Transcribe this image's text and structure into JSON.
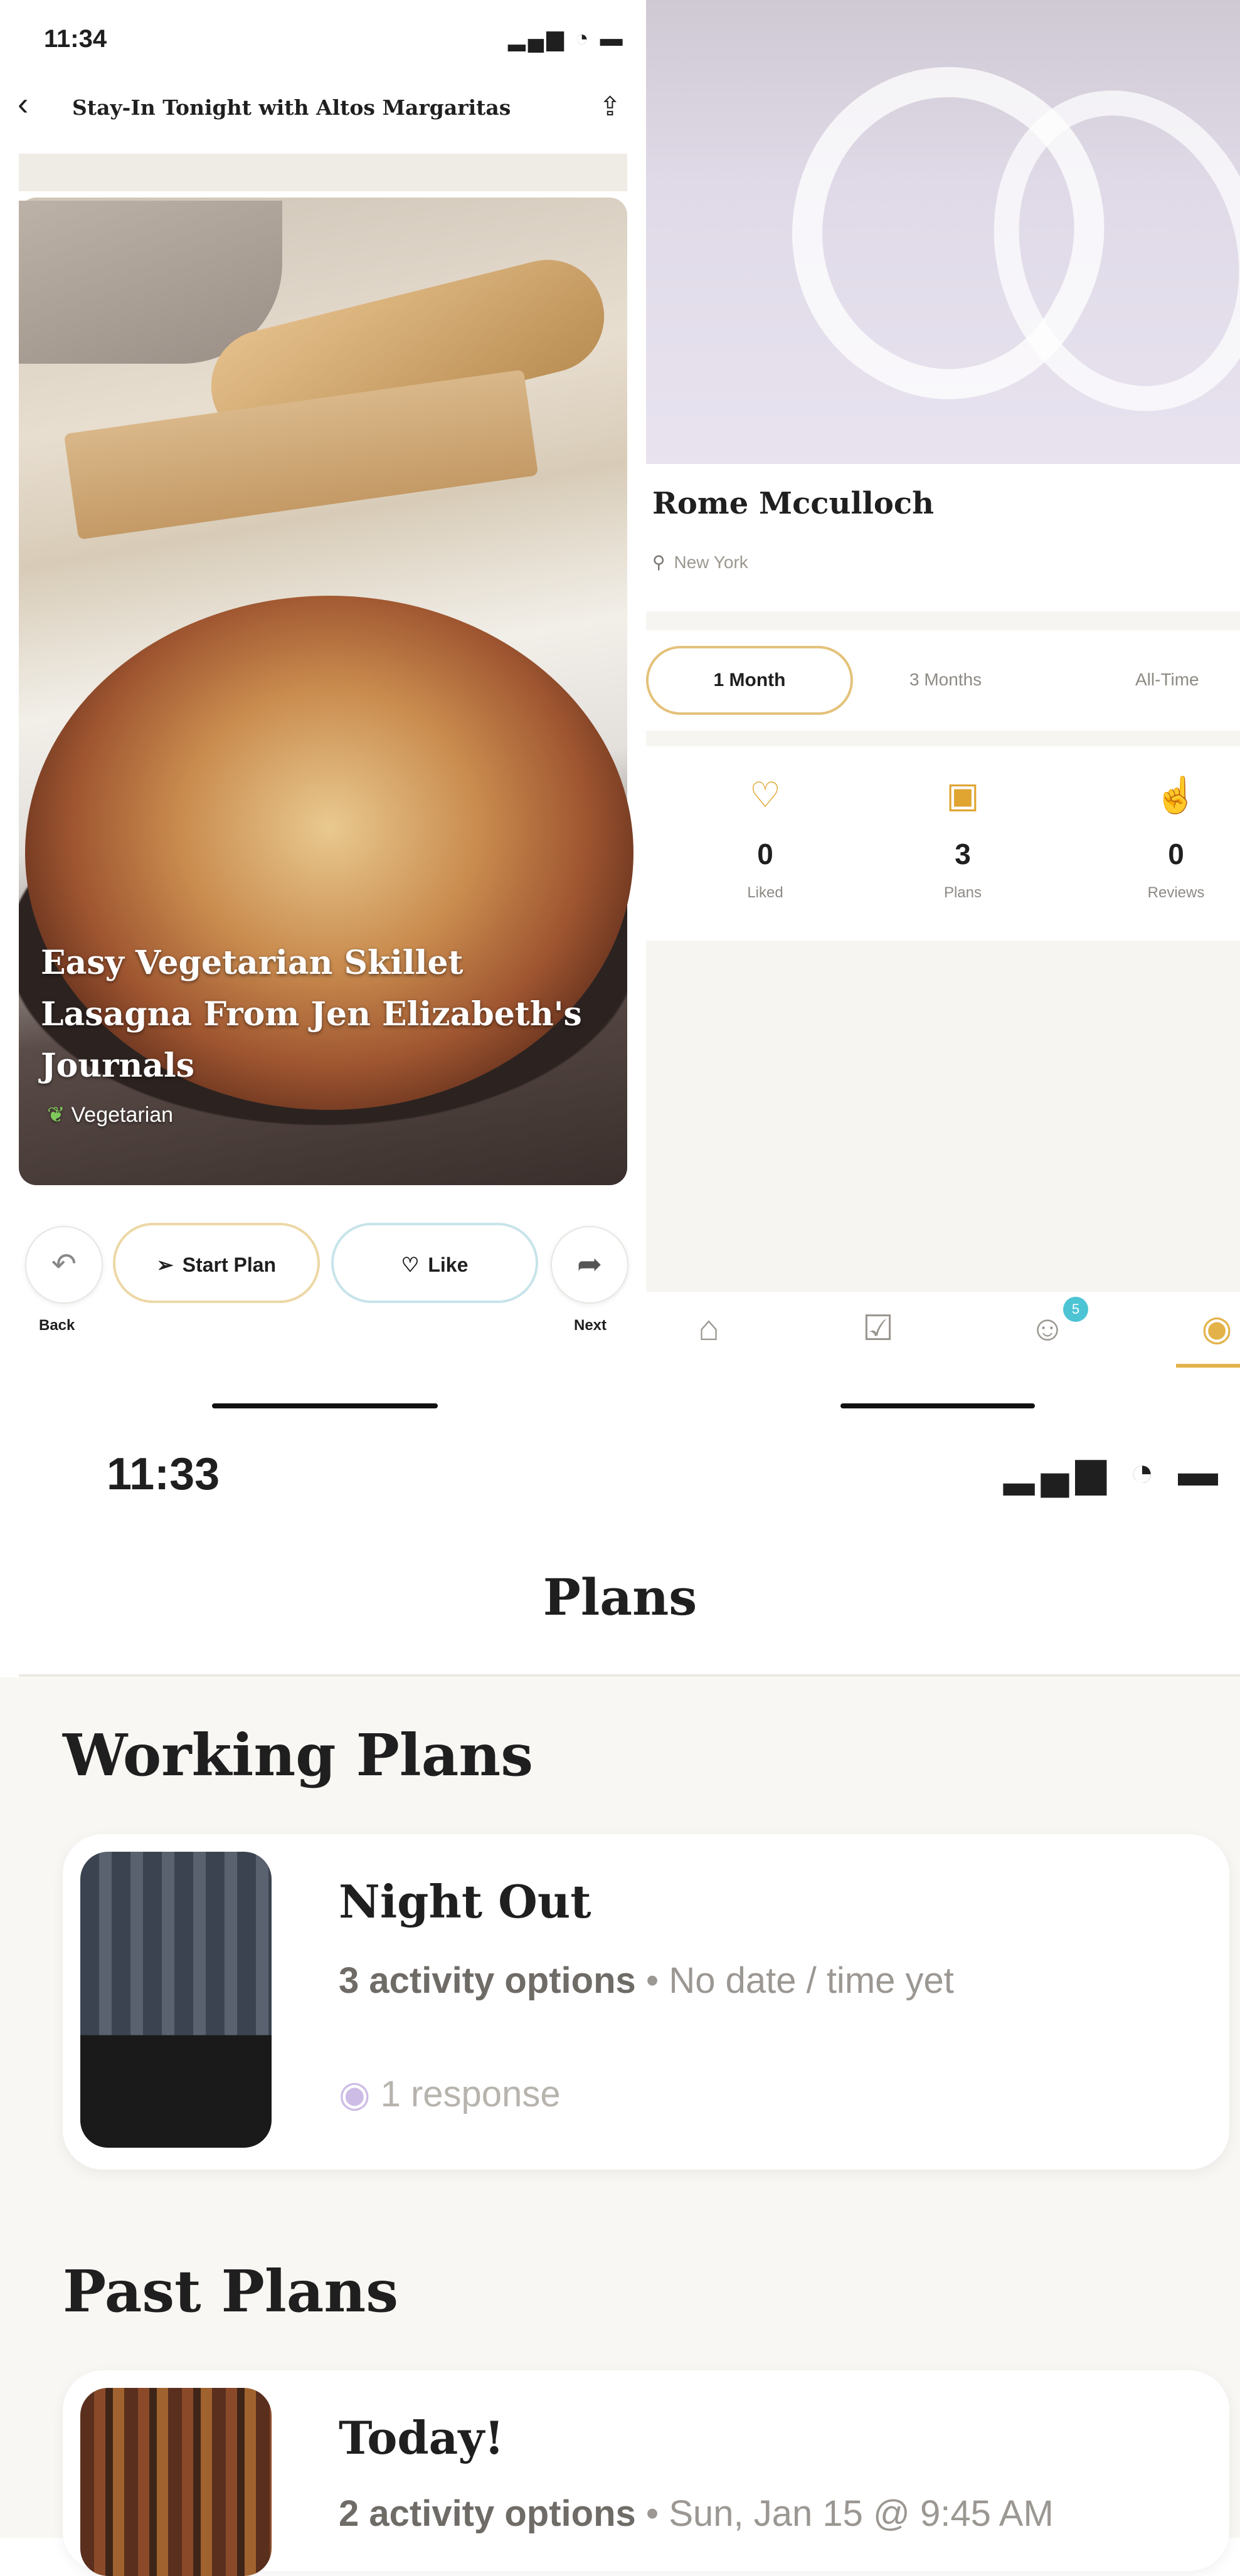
{
  "recipe_screen": {
    "status_time": "11:34",
    "status_icons": "signal wifi battery",
    "back_icon": "chevron-left",
    "title": "Stay-In Tonight with Altos Margaritas",
    "share_icon": "share",
    "recipe_title": "Easy Vegetarian Skillet Lasagna From Jen Elizabeth's Journals",
    "tag": "Vegetarian",
    "buttons": {
      "back_label": "Back",
      "start_plan": "Start Plan",
      "like": "Like",
      "next_label": "Next"
    }
  },
  "profile_screen": {
    "name": "Rome Mcculloch",
    "location": "New York",
    "tabs": [
      "1 Month",
      "3 Months",
      "All-Time"
    ],
    "active_tab": "1 Month",
    "stats": [
      {
        "value": "0",
        "label": "Liked",
        "icon": "heart-icon"
      },
      {
        "value": "3",
        "label": "Plans",
        "icon": "calendar-check-icon"
      },
      {
        "value": "0",
        "label": "Reviews",
        "icon": "thumbs-up-icon"
      }
    ],
    "tabbar": {
      "items": [
        "home",
        "plans",
        "friends",
        "profile"
      ],
      "friends_badge": "5",
      "active": "profile"
    },
    "accent_color": "#e3b34a"
  },
  "plans_screen": {
    "status_time": "11:33",
    "page_title": "Plans",
    "working_section": "Working Plans",
    "past_section": "Past Plans",
    "working_plans": [
      {
        "title": "Night Out",
        "options": "3 activity options",
        "when": "No date / time yet",
        "responses": "1 response"
      }
    ],
    "past_plans": [
      {
        "title": "Today!",
        "options": "2 activity options",
        "when": "Sun, Jan 15 @ 9:45 AM"
      }
    ]
  }
}
